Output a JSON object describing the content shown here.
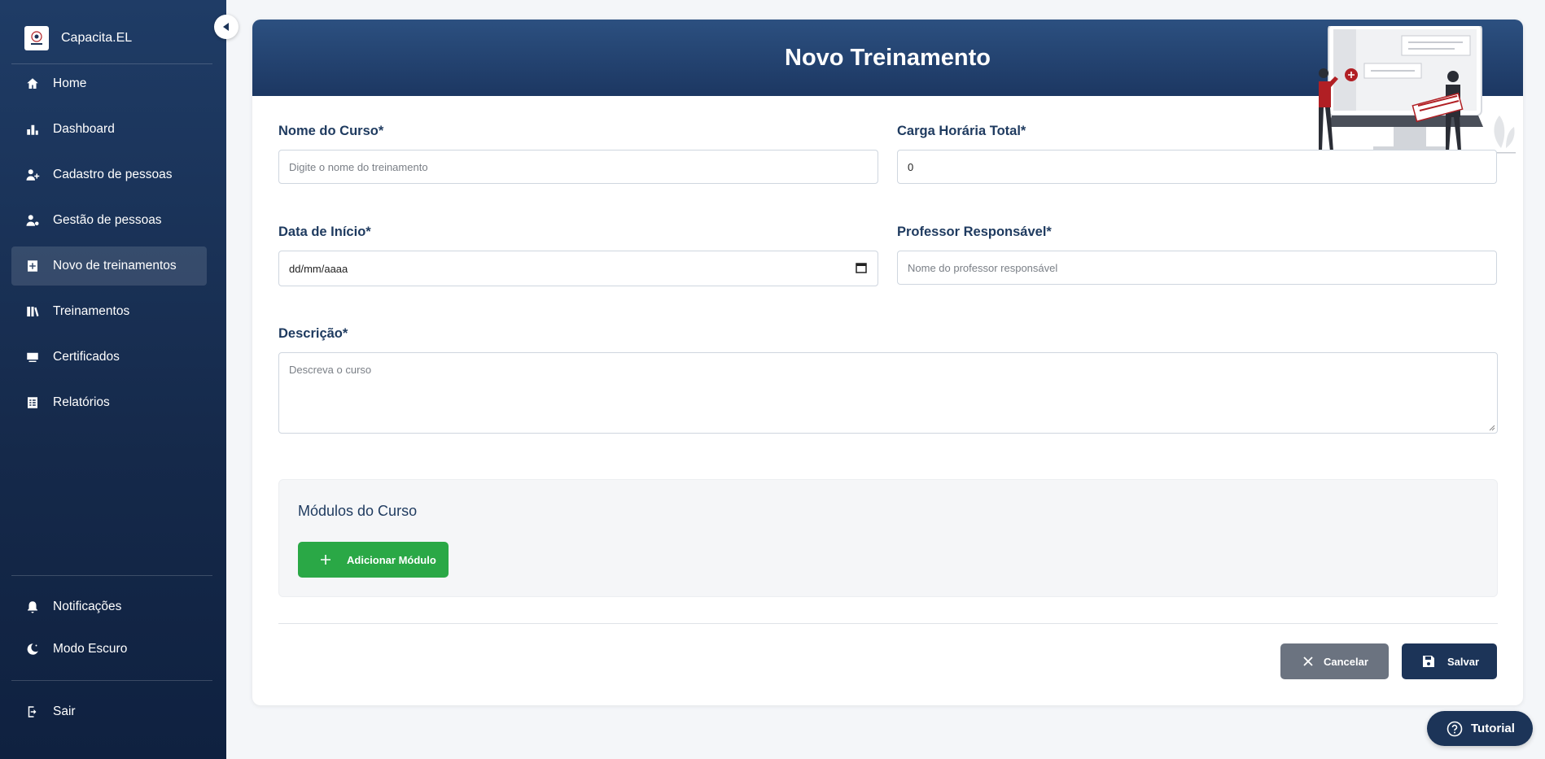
{
  "brand": {
    "name": "Capacita.EL"
  },
  "sidebar": {
    "items": [
      {
        "label": "Home",
        "icon": "home-icon"
      },
      {
        "label": "Dashboard",
        "icon": "bar-chart-icon"
      },
      {
        "label": "Cadastro de pessoas",
        "icon": "add-person-icon"
      },
      {
        "label": "Gestão de pessoas",
        "icon": "person-settings-icon"
      },
      {
        "label": "Novo de treinamentos",
        "icon": "add-box-icon",
        "active": true
      },
      {
        "label": "Treinamentos",
        "icon": "books-icon"
      },
      {
        "label": "Certificados",
        "icon": "certificate-icon"
      },
      {
        "label": "Relatórios",
        "icon": "report-icon"
      }
    ],
    "bottom": [
      {
        "label": "Notificações",
        "icon": "bell-icon"
      },
      {
        "label": "Modo Escuro",
        "icon": "moon-icon"
      }
    ],
    "logout": {
      "label": "Sair",
      "icon": "logout-icon"
    }
  },
  "page": {
    "title": "Novo Treinamento"
  },
  "form": {
    "course_name": {
      "label": "Nome do Curso*",
      "placeholder": "Digite o nome do treinamento",
      "value": ""
    },
    "total_hours": {
      "label": "Carga Horária Total*",
      "value": "0"
    },
    "start_date": {
      "label": "Data de Início*",
      "placeholder": "dd/mm/aaaa"
    },
    "teacher": {
      "label": "Professor Responsável*",
      "placeholder": "Nome do professor responsável"
    },
    "description": {
      "label": "Descrição*",
      "placeholder": "Descreva o curso"
    }
  },
  "modules": {
    "title": "Módulos do Curso",
    "add_label": "Adicionar Módulo"
  },
  "actions": {
    "cancel_label": "Cancelar",
    "save_label": "Salvar"
  },
  "tutorial": {
    "label": "Tutorial"
  },
  "colors": {
    "primary": "#1c3458",
    "accent_green": "#2aa846",
    "cancel_gray": "#6b7380",
    "illustration_red": "#b11f24"
  }
}
